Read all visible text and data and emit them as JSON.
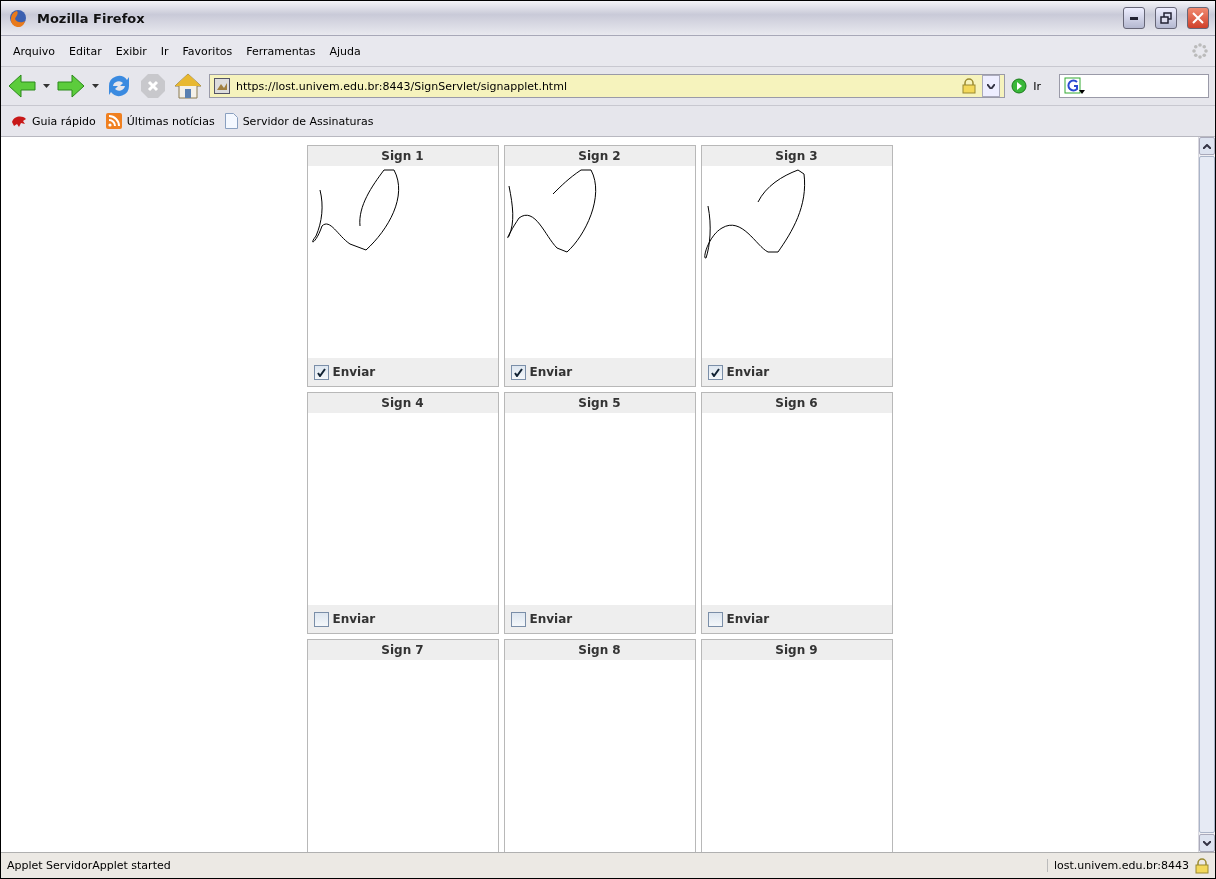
{
  "window": {
    "title": "Mozilla Firefox"
  },
  "menu": [
    "Arquivo",
    "Editar",
    "Exibir",
    "Ir",
    "Favoritos",
    "Ferramentas",
    "Ajuda"
  ],
  "address": {
    "value": "https://lost.univem.edu.br:8443/SignServlet/signapplet.html",
    "go": "Ir"
  },
  "bookmarks": [
    {
      "label": "Guia rápido",
      "kind": "help"
    },
    {
      "label": "Últimas notícias",
      "kind": "feed"
    },
    {
      "label": "Servidor de Assinaturas",
      "kind": "page"
    }
  ],
  "signs": [
    {
      "title": "Sign 1",
      "signed": true,
      "send": {
        "label": "Enviar",
        "checked": true
      }
    },
    {
      "title": "Sign 2",
      "signed": true,
      "send": {
        "label": "Enviar",
        "checked": true
      }
    },
    {
      "title": "Sign 3",
      "signed": true,
      "send": {
        "label": "Enviar",
        "checked": true
      }
    },
    {
      "title": "Sign 4",
      "signed": false,
      "send": {
        "label": "Enviar",
        "checked": false
      }
    },
    {
      "title": "Sign 5",
      "signed": false,
      "send": {
        "label": "Enviar",
        "checked": false
      }
    },
    {
      "title": "Sign 6",
      "signed": false,
      "send": {
        "label": "Enviar",
        "checked": false
      }
    },
    {
      "title": "Sign 7",
      "signed": false
    },
    {
      "title": "Sign 8",
      "signed": false
    },
    {
      "title": "Sign 9",
      "signed": false
    }
  ],
  "status_bar": {
    "message": "Applet ServidorApplet started",
    "host": "lost.univem.edu.br:8443"
  }
}
